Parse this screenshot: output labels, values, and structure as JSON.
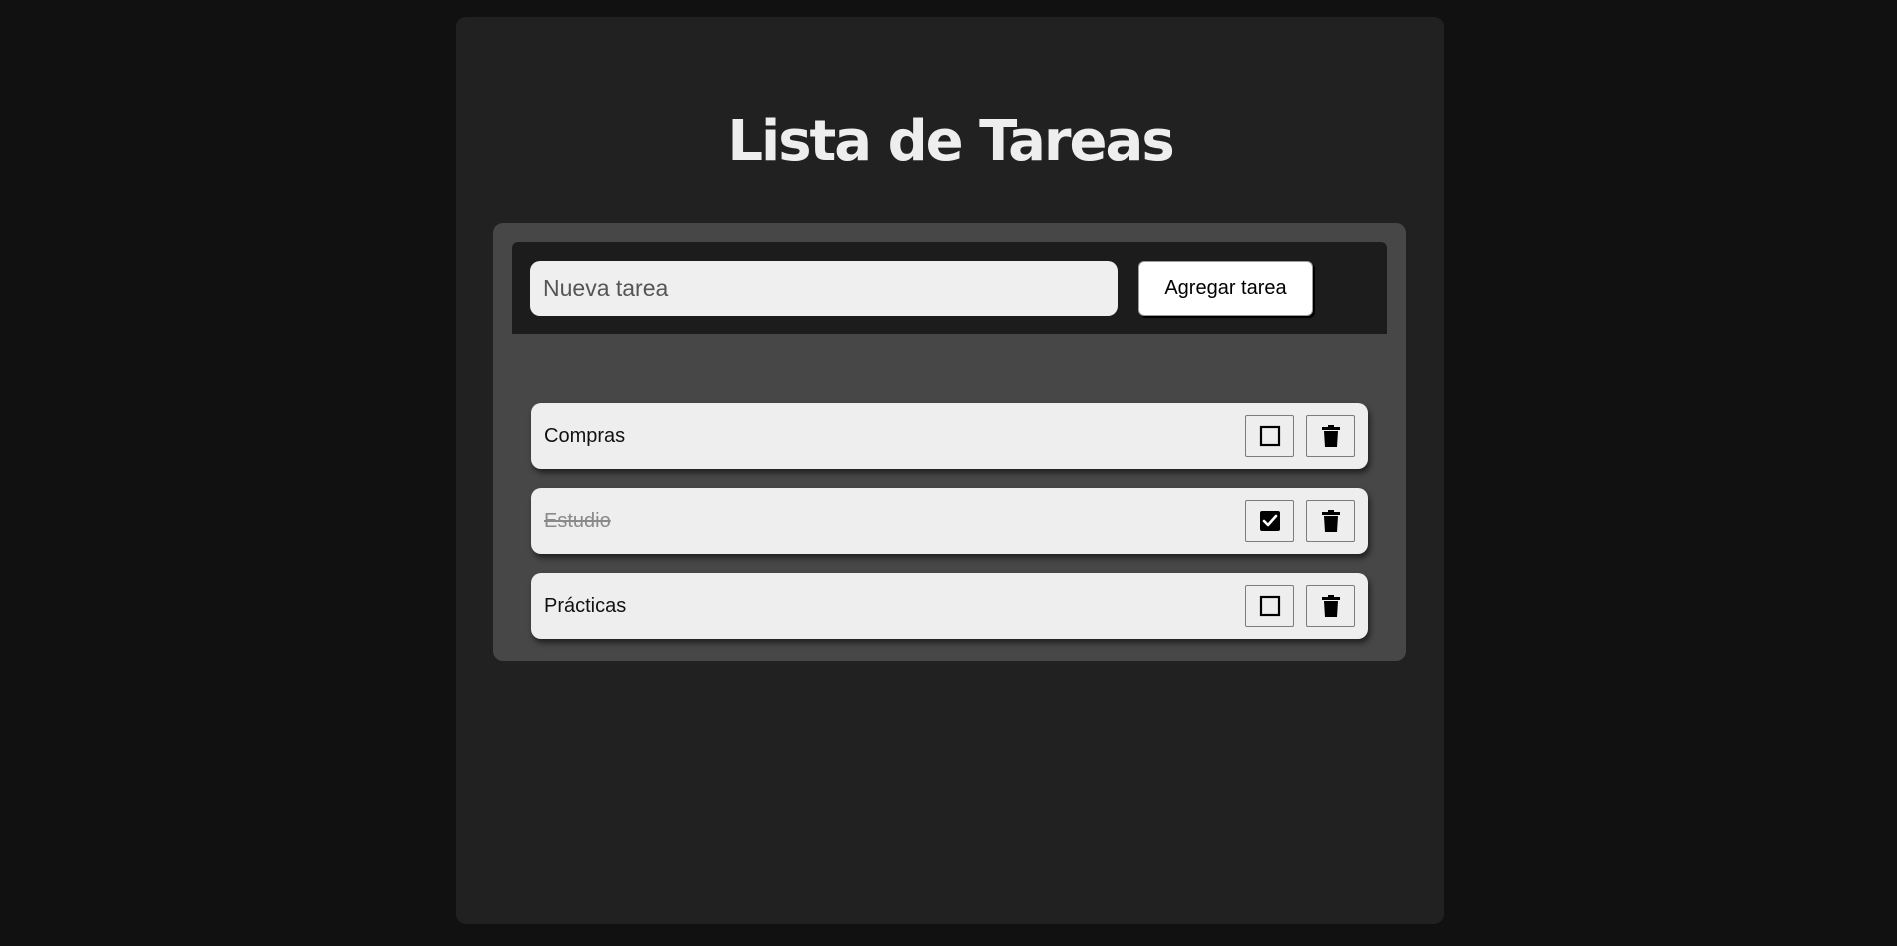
{
  "app": {
    "title": "Lista de Tareas"
  },
  "form": {
    "input_value": "",
    "input_placeholder": "Nueva tarea",
    "add_button_label": "Agregar tarea"
  },
  "tasks": [
    {
      "text": "Compras",
      "done": false,
      "check_icon": "checkbox-empty-icon",
      "delete_icon": "trash-icon"
    },
    {
      "text": "Estudio",
      "done": true,
      "check_icon": "checkbox-checked-icon",
      "delete_icon": "trash-icon"
    },
    {
      "text": "Prácticas",
      "done": false,
      "check_icon": "checkbox-empty-icon",
      "delete_icon": "trash-icon"
    }
  ],
  "colors": {
    "page_background": "#111111",
    "app_background": "#212121",
    "panel_background": "#474747",
    "form_bar_background": "#1c1c1c",
    "item_background": "#efeeef",
    "title_color": "#eeeeee",
    "done_text_color": "#8a8a8a"
  }
}
